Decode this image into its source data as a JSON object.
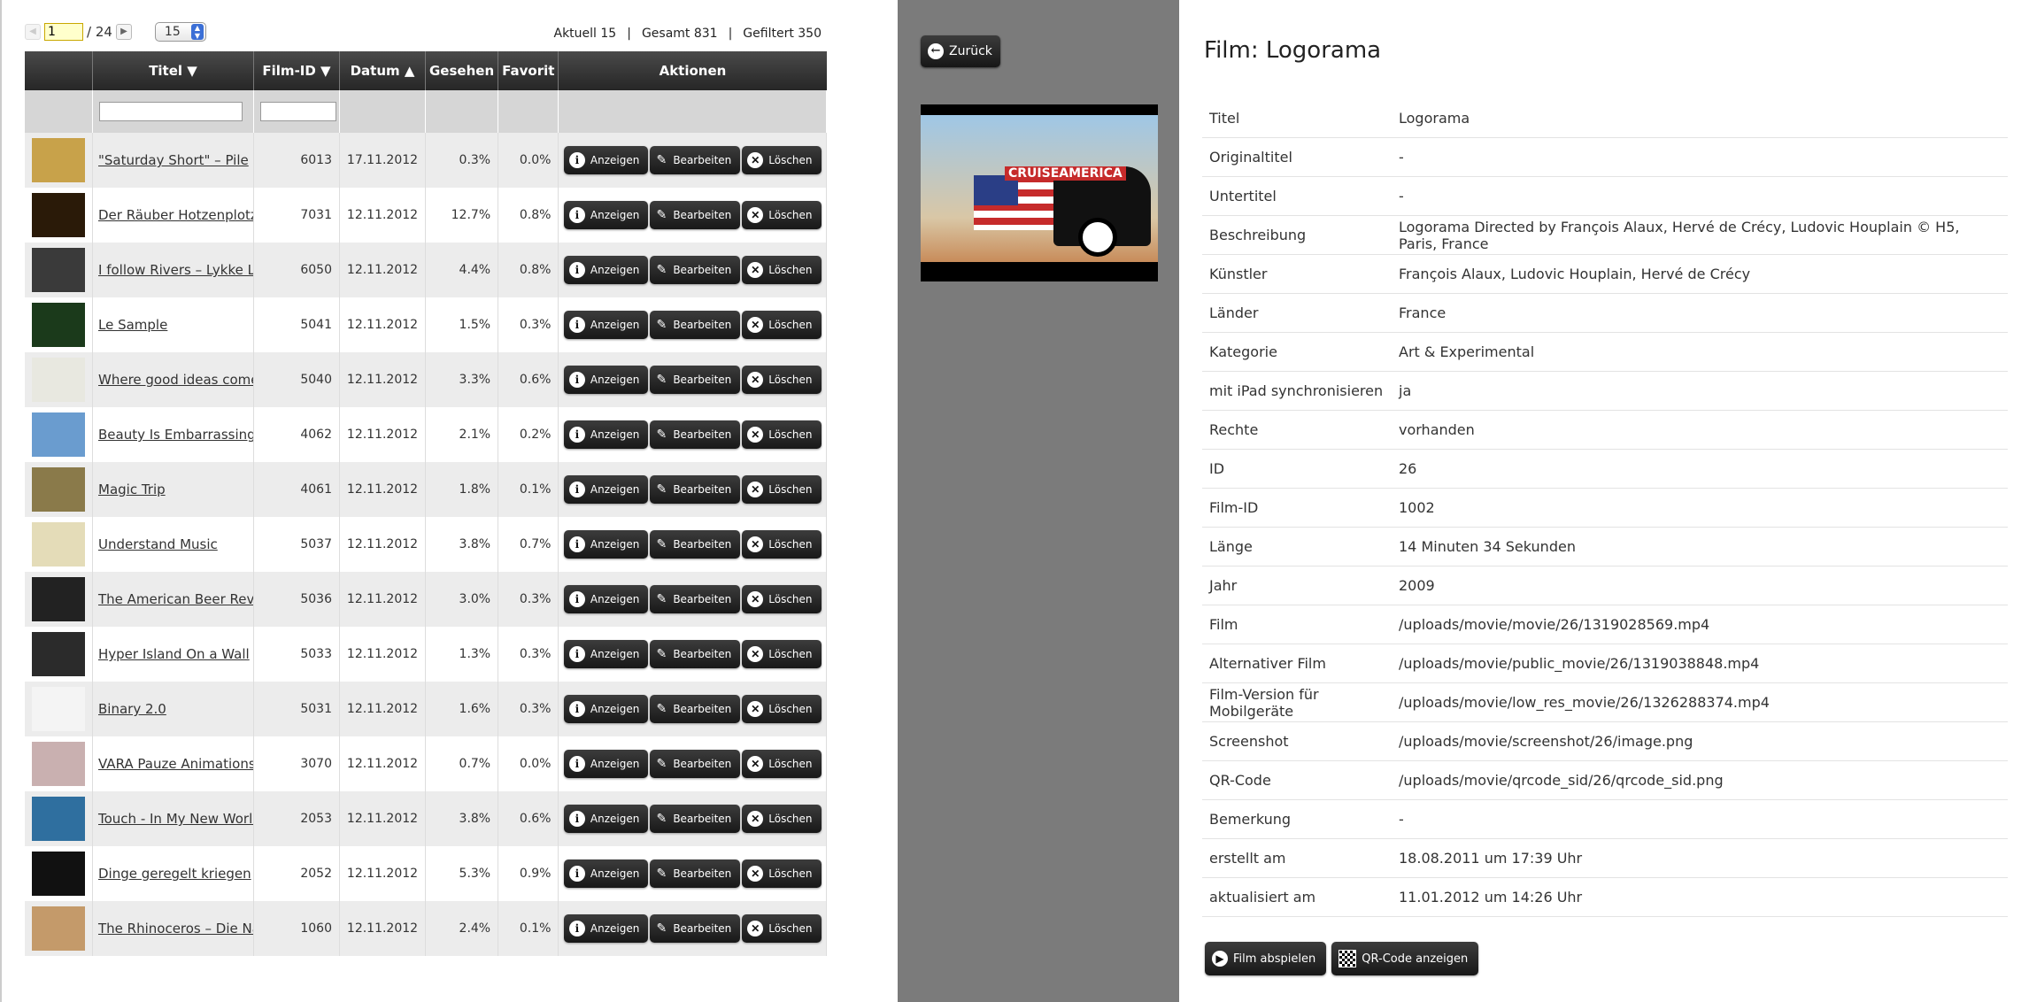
{
  "pager": {
    "prev_icon": "arrow-left-icon",
    "next_icon": "arrow-right-icon",
    "page_value": "1",
    "page_total": "/ 24",
    "per_page": "15"
  },
  "stats": {
    "current": "Aktuell 15",
    "total": "Gesamt 831",
    "filtered": "Gefiltert 350"
  },
  "table": {
    "headers": {
      "title": "Titel ▼",
      "film_id": "Film-ID ▼",
      "date": "Datum ▲",
      "seen": "Gesehen",
      "favorite": "Favorit",
      "actions": "Aktionen"
    },
    "buttons": {
      "view": "Anzeigen",
      "edit": "Bearbeiten",
      "delete": "Löschen"
    },
    "rows": [
      {
        "title": "\"Saturday Short\" – Pile",
        "film_id": "6013",
        "date": "17.11.2012",
        "seen": "0.3%",
        "favorite": "0.0%",
        "thumb": "#c8a24a"
      },
      {
        "title": "Der Räuber Hotzenplotz",
        "film_id": "7031",
        "date": "12.11.2012",
        "seen": "12.7%",
        "favorite": "0.8%",
        "thumb": "#2a1a08"
      },
      {
        "title": "I follow Rivers – Lykke Li",
        "film_id": "6050",
        "date": "12.11.2012",
        "seen": "4.4%",
        "favorite": "0.8%",
        "thumb": "#3a3a3a"
      },
      {
        "title": "Le Sample",
        "film_id": "5041",
        "date": "12.11.2012",
        "seen": "1.5%",
        "favorite": "0.3%",
        "thumb": "#1b3a1b"
      },
      {
        "title": "Where good ideas come fr",
        "film_id": "5040",
        "date": "12.11.2012",
        "seen": "3.3%",
        "favorite": "0.6%",
        "thumb": "#e8e8e0"
      },
      {
        "title": "Beauty Is Embarrassing",
        "film_id": "4062",
        "date": "12.11.2012",
        "seen": "2.1%",
        "favorite": "0.2%",
        "thumb": "#6a9ccf"
      },
      {
        "title": "Magic Trip",
        "film_id": "4061",
        "date": "12.11.2012",
        "seen": "1.8%",
        "favorite": "0.1%",
        "thumb": "#8a7a4a"
      },
      {
        "title": "Understand Music",
        "film_id": "5037",
        "date": "12.11.2012",
        "seen": "3.8%",
        "favorite": "0.7%",
        "thumb": "#e4dcb8"
      },
      {
        "title": "The American Beer Reviva",
        "film_id": "5036",
        "date": "12.11.2012",
        "seen": "3.0%",
        "favorite": "0.3%",
        "thumb": "#222222"
      },
      {
        "title": "Hyper Island On a Wall",
        "film_id": "5033",
        "date": "12.11.2012",
        "seen": "1.3%",
        "favorite": "0.3%",
        "thumb": "#2b2b2b"
      },
      {
        "title": "Binary 2.0",
        "film_id": "5031",
        "date": "12.11.2012",
        "seen": "1.6%",
        "favorite": "0.3%",
        "thumb": "#f4f4f4"
      },
      {
        "title": "VARA Pauze Animations",
        "film_id": "3070",
        "date": "12.11.2012",
        "seen": "0.7%",
        "favorite": "0.0%",
        "thumb": "#c9b0b0"
      },
      {
        "title": "Touch - In My New World",
        "film_id": "2053",
        "date": "12.11.2012",
        "seen": "3.8%",
        "favorite": "0.6%",
        "thumb": "#2f6f9f"
      },
      {
        "title": "Dinge geregelt kriegen",
        "film_id": "2052",
        "date": "12.11.2012",
        "seen": "5.3%",
        "favorite": "0.9%",
        "thumb": "#111111"
      },
      {
        "title": "The Rhinoceros – Die Nas",
        "film_id": "1060",
        "date": "12.11.2012",
        "seen": "2.4%",
        "favorite": "0.1%",
        "thumb": "#c49a6a"
      }
    ]
  },
  "back_label": "Zurück",
  "preview": {
    "sign_text": "CRUISEAMERICA"
  },
  "detail": {
    "heading": "Film: Logorama",
    "fields": [
      {
        "label": "Titel",
        "value": "Logorama"
      },
      {
        "label": "Originaltitel",
        "value": "-"
      },
      {
        "label": "Untertitel",
        "value": "-"
      },
      {
        "label": "Beschreibung",
        "value": "Logorama Directed by François Alaux, Hervé de Crécy, Ludovic Houplain © H5, Paris, France"
      },
      {
        "label": "Künstler",
        "value": "François Alaux, Ludovic Houplain, Hervé de Crécy"
      },
      {
        "label": "Länder",
        "value": "France"
      },
      {
        "label": "Kategorie",
        "value": "Art & Experimental"
      },
      {
        "label": "mit iPad synchronisieren",
        "value": "ja"
      },
      {
        "label": "Rechte",
        "value": "vorhanden"
      },
      {
        "label": "ID",
        "value": "26"
      },
      {
        "label": "Film-ID",
        "value": "1002"
      },
      {
        "label": "Länge",
        "value": "14 Minuten 34 Sekunden"
      },
      {
        "label": "Jahr",
        "value": "2009"
      },
      {
        "label": "Film",
        "value": "/uploads/movie/movie/26/1319028569.mp4"
      },
      {
        "label": "Alternativer Film",
        "value": "/uploads/movie/public_movie/26/1319038848.mp4"
      },
      {
        "label": "Film-Version für Mobilgeräte",
        "value": "/uploads/movie/low_res_movie/26/1326288374.mp4"
      },
      {
        "label": "Screenshot",
        "value": "/uploads/movie/screenshot/26/image.png"
      },
      {
        "label": "QR-Code",
        "value": "/uploads/movie/qrcode_sid/26/qrcode_sid.png"
      },
      {
        "label": "Bemerkung",
        "value": "-"
      },
      {
        "label": "erstellt am",
        "value": "18.08.2011 um 17:39 Uhr"
      },
      {
        "label": "aktualisiert am",
        "value": "11.01.2012 um 14:26 Uhr"
      }
    ],
    "play_label": "Film abspielen",
    "qr_label": "QR-Code anzeigen"
  }
}
